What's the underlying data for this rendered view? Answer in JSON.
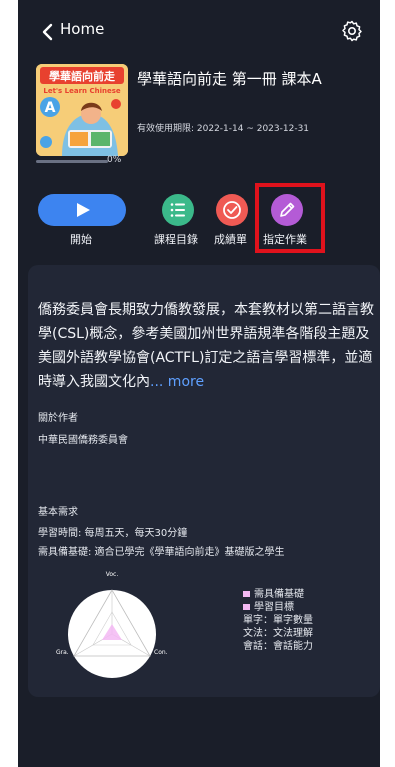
{
  "header": {
    "back_label": "Home"
  },
  "book": {
    "title": "學華語向前走 第一冊 課本A",
    "validity": "有效使用期限: 2022-1-14 ~ 2023-12-31",
    "progress_percent": 0,
    "progress_label": "0%",
    "cover_title": "學華語向前走",
    "cover_subtitle": "Let's Learn Chinese",
    "cover_letter": "A"
  },
  "actions": {
    "start": "開始",
    "catalog": "課程目錄",
    "report": "成績單",
    "assign": "指定作業"
  },
  "description": {
    "text": "僑務委員會長期致力僑教發展，本套教材以第二語言教學(CSL)概念，參考美國加州世界語規準各階段主題及美國外語教學協會(ACTFL)訂定之語言學習標準，並適時導入我國文化內",
    "more": "... more"
  },
  "author": {
    "heading": "關於作者",
    "name": "中華民國僑務委員會"
  },
  "requirements": {
    "heading": "基本需求",
    "study_time": "學習時間: 每周五天，每天30分鐘",
    "prerequisite": "需具備基礎: 適合已學完《學華語向前走》基礎版之學生"
  },
  "radar": {
    "labels": {
      "top": "Voc.",
      "left": "Gra.",
      "right": "Con."
    },
    "legend": [
      "需具備基礎",
      "學習目標",
      "單字：單字數量",
      "文法：文法理解",
      "會話：會話能力"
    ]
  },
  "colors": {
    "background": "#1a1e29",
    "card": "#222736",
    "start": "#3d84f0",
    "catalog": "#3bb98a",
    "report": "#ef5a54",
    "assign": "#b45bd6",
    "highlight": "#e0121c",
    "legend": "#f3b9f3"
  }
}
